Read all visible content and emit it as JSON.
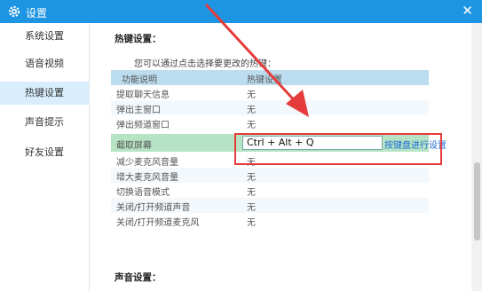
{
  "window": {
    "title": "设置",
    "close_glyph": "✕"
  },
  "sidebar": {
    "items": [
      {
        "label": "系统设置",
        "active": false
      },
      {
        "label": "语音视频",
        "active": false
      },
      {
        "label": "热键设置",
        "active": true
      },
      {
        "label": "声音提示",
        "active": false
      },
      {
        "label": "好友设置",
        "active": false
      }
    ]
  },
  "hotkeys": {
    "heading": "热键设置：",
    "note": "您可以通过点击选择要更改的热键：",
    "columns": [
      "功能说明",
      "热键设置"
    ],
    "rows": [
      {
        "function": "提取聊天信息",
        "key": "无"
      },
      {
        "function": "弹出主窗口",
        "key": "无"
      },
      {
        "function": "弹出频道窗口",
        "key": "无"
      },
      {
        "function": "截取屏幕",
        "key": "Ctrl + Alt + Q",
        "selected": true,
        "action": "按键盘进行设置"
      },
      {
        "function": "减少麦克风音量",
        "key": "无"
      },
      {
        "function": "增大麦克风音量",
        "key": "无"
      },
      {
        "function": "切换语音模式",
        "key": "无"
      },
      {
        "function": "关闭/打开频道声音",
        "key": "无"
      },
      {
        "function": "关闭/打开频道麦克风",
        "key": "无"
      }
    ]
  },
  "sound": {
    "heading": "声音设置："
  },
  "colors": {
    "titlebar": "#1e95e2",
    "selected_row": "#b6e3c4",
    "highlight": "#e53b3b"
  }
}
